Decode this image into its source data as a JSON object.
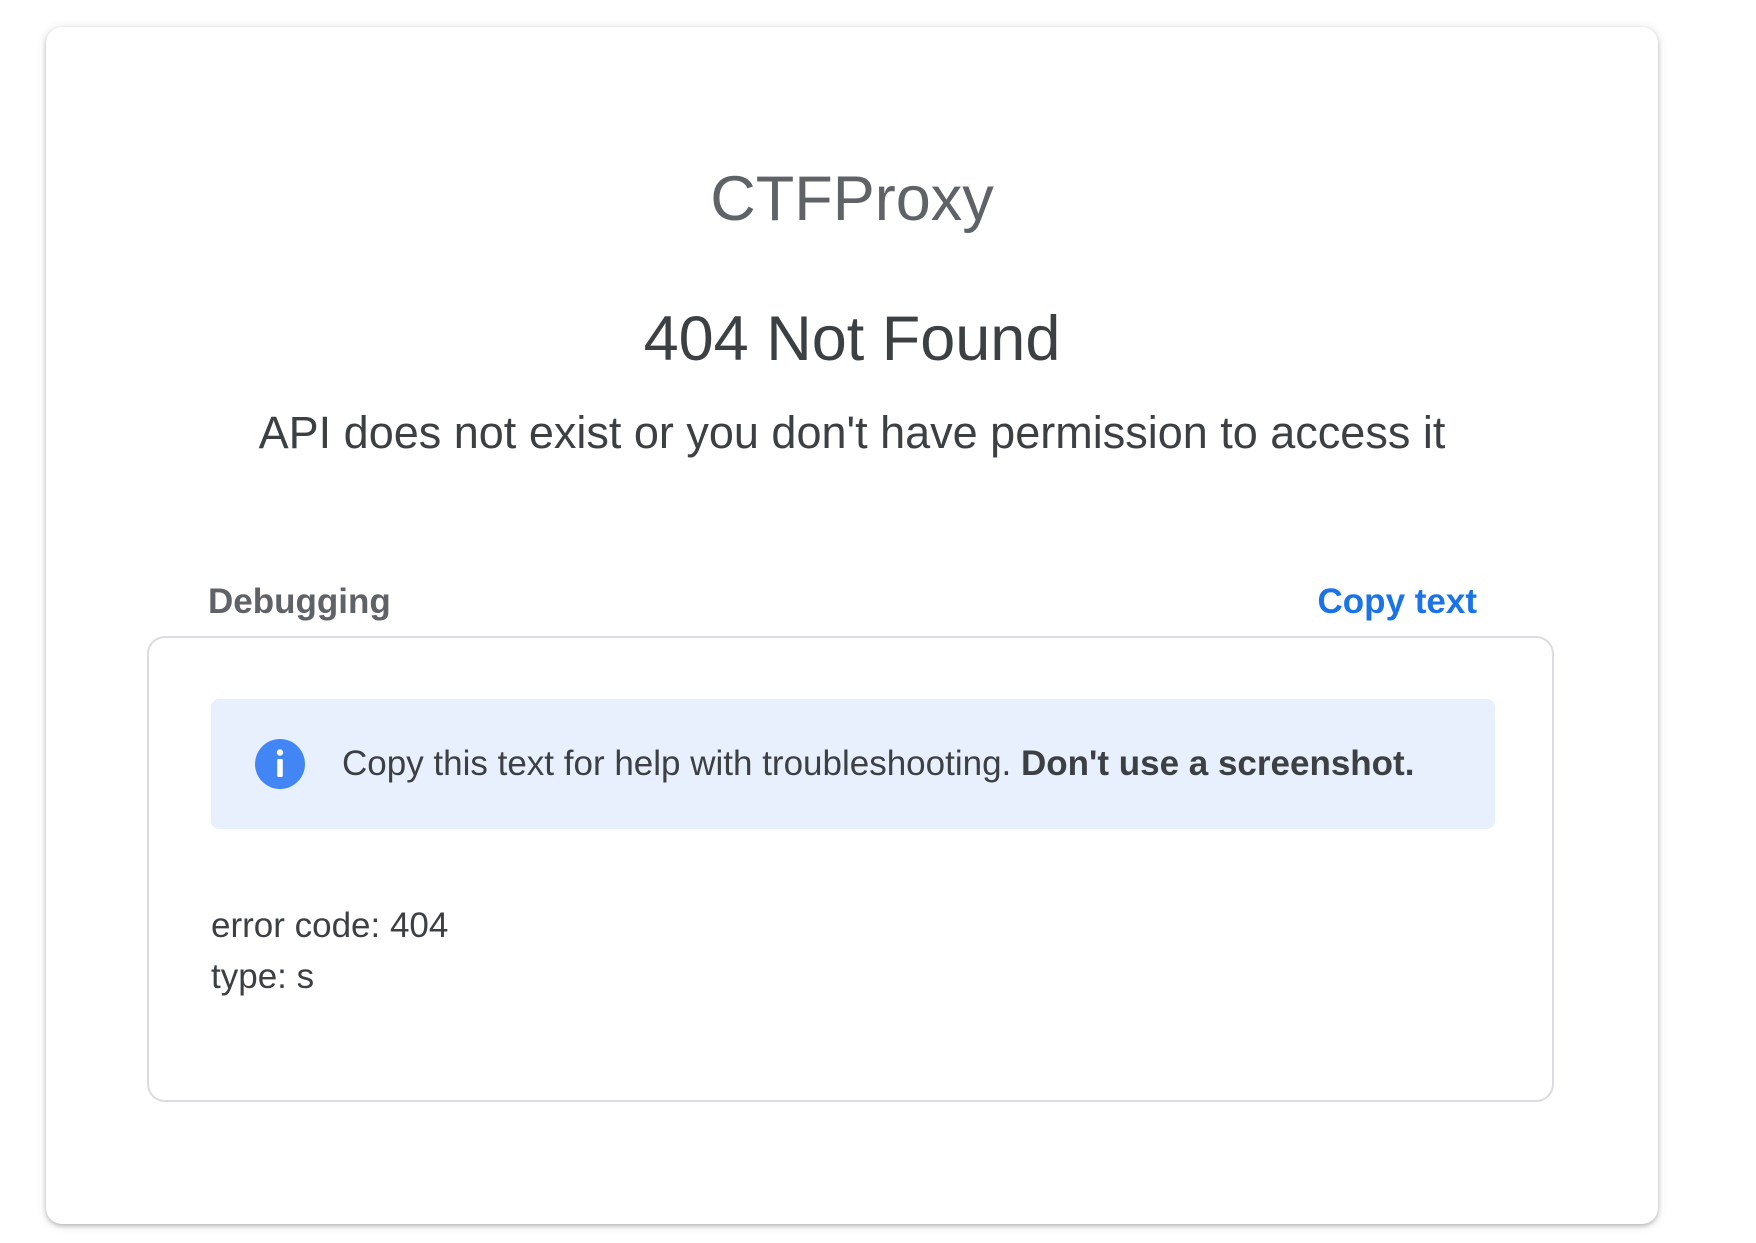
{
  "brand": "CTFProxy",
  "error": {
    "title": "404 Not Found",
    "message": "API does not exist or you don't have permission to access it"
  },
  "debugging": {
    "label": "Debugging",
    "copy_label": "Copy text",
    "info_icon": "info-icon",
    "info_text": "Copy this text for help with troubleshooting.",
    "info_emphasis": "Don't use a screenshot.",
    "lines": [
      "error code: 404",
      "type: s"
    ]
  },
  "colors": {
    "accent": "#1a73e8",
    "banner_background": "#e8f0fe",
    "icon_blue": "#4285f4",
    "text_primary": "#3c4043",
    "text_secondary": "#5f6368"
  }
}
